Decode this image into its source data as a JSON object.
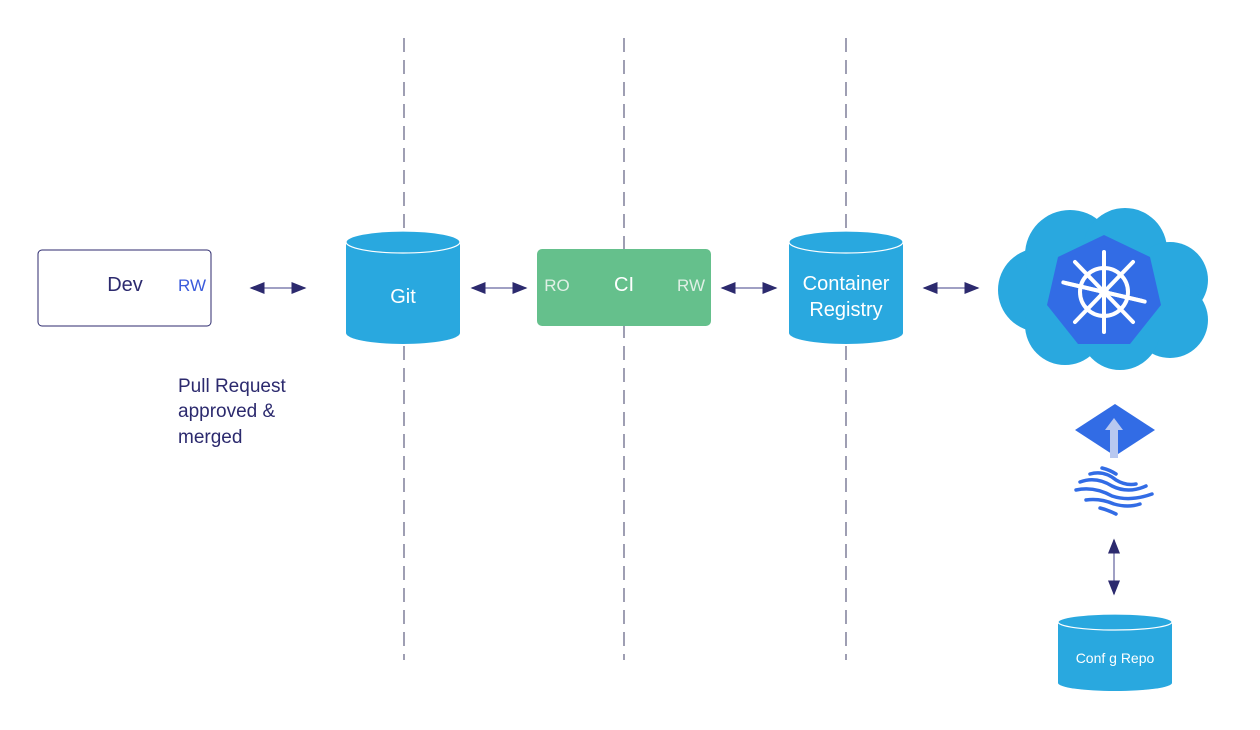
{
  "nodes": {
    "dev": {
      "label": "Dev",
      "access": "RW"
    },
    "git": {
      "label": "Git"
    },
    "ci": {
      "label": "CI",
      "left_access": "RO",
      "right_access": "RW"
    },
    "registry": {
      "label_line1": "Container",
      "label_line2": "Registry"
    },
    "cluster": {
      "icon": "kubernetes-icon"
    },
    "gitops_agent": {
      "icon": "flux-icon"
    },
    "config_repo": {
      "label": "Conf g Repo"
    }
  },
  "annotation": {
    "line1": "Pull Request",
    "line2": "approved &",
    "line3": "merged"
  },
  "colors": {
    "cylinder": "#29a8df",
    "ci": "#65c08c",
    "k8s": "#326ce5",
    "arrow": "#2c2a6e",
    "dev_text": "#2c2a6e",
    "rw_text": "#3b5bdb",
    "divider": "#6b6b8a"
  }
}
